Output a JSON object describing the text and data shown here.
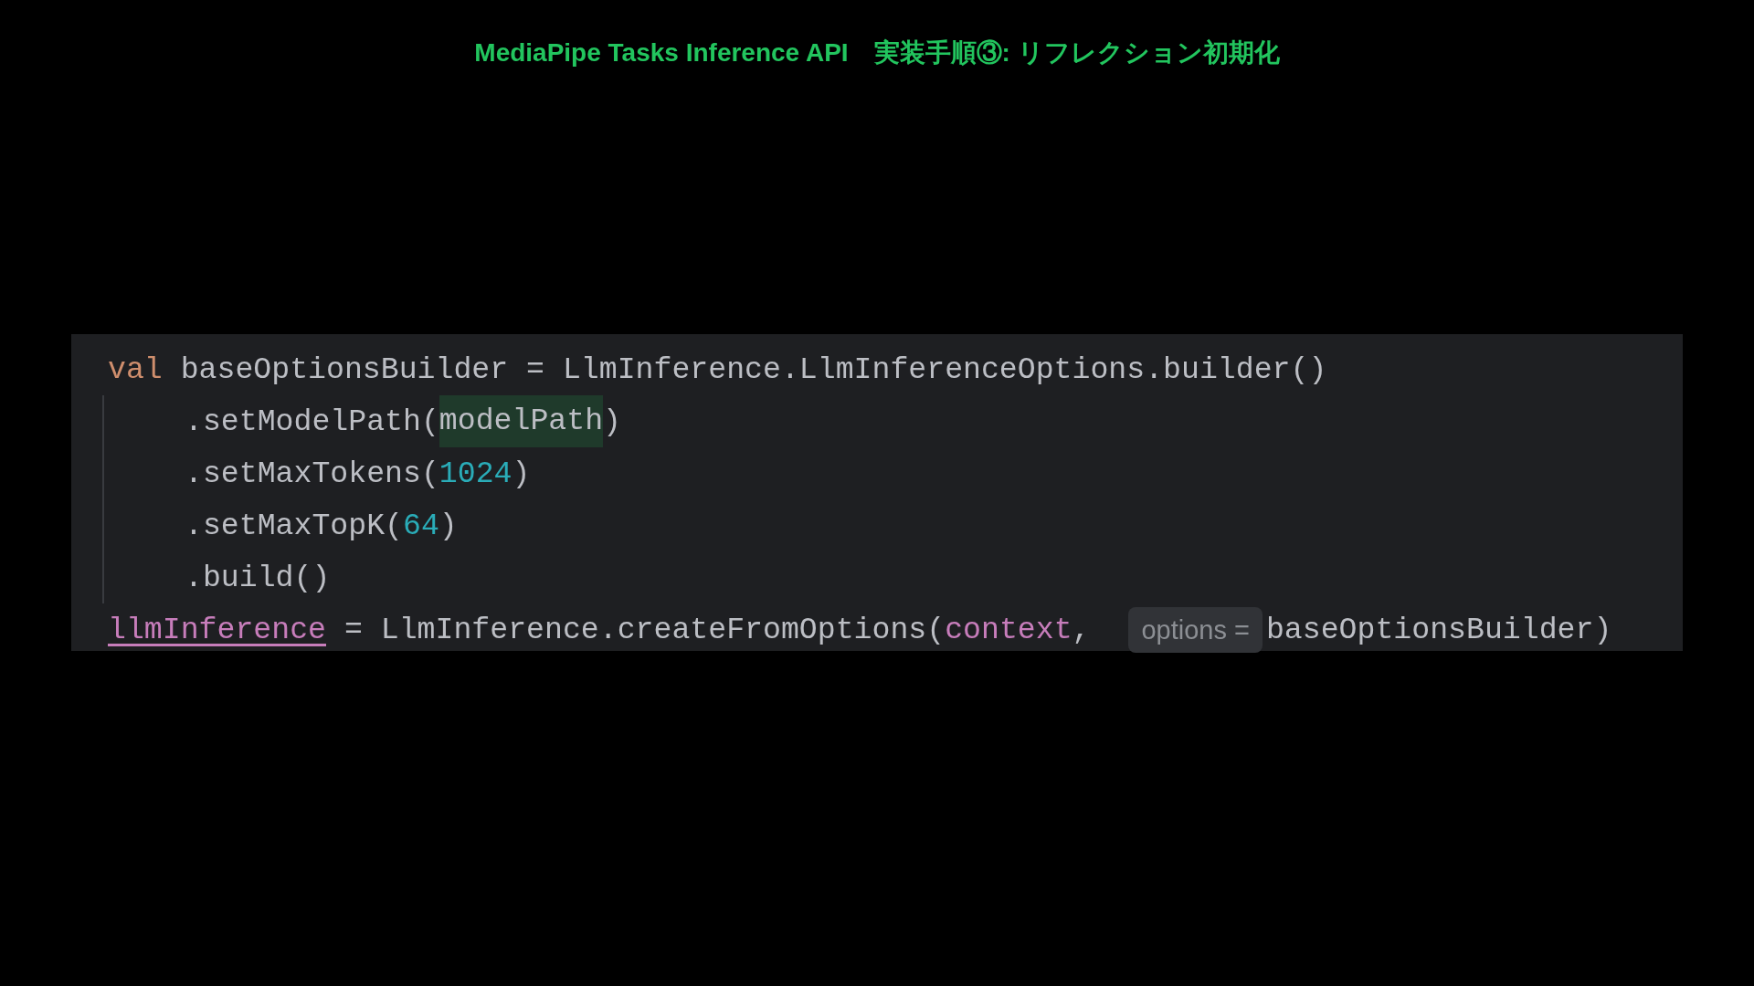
{
  "title": "MediaPipe Tasks Inference API　実装手順③: リフレクション初期化",
  "code_lines": [
    {
      "indented": false,
      "tokens": [
        {
          "kind": "keyword",
          "text": "val"
        },
        {
          "kind": "plain",
          "text": " baseOptionsBuilder = LlmInference.LlmInferenceOptions.builder()"
        }
      ]
    },
    {
      "indented": true,
      "tokens": [
        {
          "kind": "plain",
          "text": ".setModelPath("
        },
        {
          "kind": "highlight",
          "text": "modelPath"
        },
        {
          "kind": "plain",
          "text": ")"
        }
      ]
    },
    {
      "indented": true,
      "tokens": [
        {
          "kind": "plain",
          "text": ".setMaxTokens("
        },
        {
          "kind": "number",
          "text": "1024"
        },
        {
          "kind": "plain",
          "text": ")"
        }
      ]
    },
    {
      "indented": true,
      "tokens": [
        {
          "kind": "plain",
          "text": ".setMaxTopK("
        },
        {
          "kind": "number",
          "text": "64"
        },
        {
          "kind": "plain",
          "text": ")"
        }
      ]
    },
    {
      "indented": true,
      "tokens": [
        {
          "kind": "plain",
          "text": ".build()"
        }
      ]
    },
    {
      "indented": false,
      "tokens": [
        {
          "kind": "property",
          "text": "llmInference"
        },
        {
          "kind": "plain",
          "text": " = LlmInference.createFromOptions("
        },
        {
          "kind": "param",
          "text": "context"
        },
        {
          "kind": "plain",
          "text": ", "
        },
        {
          "kind": "hint",
          "text": "options ="
        },
        {
          "kind": "plain",
          "text": "baseOptionsBuilder)"
        }
      ]
    }
  ]
}
